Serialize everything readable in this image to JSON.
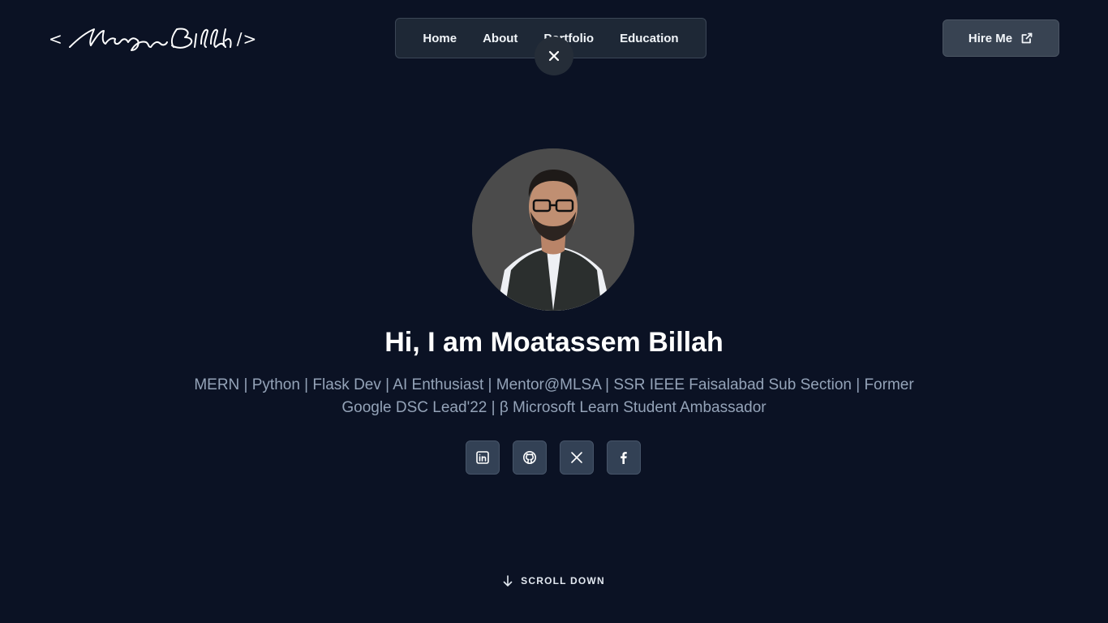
{
  "logo": {
    "open": "<",
    "name": "Moatassem Billah",
    "close": "/>"
  },
  "nav": {
    "items": [
      {
        "label": "Home"
      },
      {
        "label": "About"
      },
      {
        "label": "Portfolio"
      },
      {
        "label": "Education"
      }
    ],
    "close_icon": "close-icon"
  },
  "hire": {
    "label": "Hire Me",
    "icon": "external-link-icon"
  },
  "hero": {
    "headline": "Hi, I am Moatassem Billah",
    "tagline": "MERN | Python | Flask Dev | AI Enthusiast | Mentor@MLSA | SSR IEEE Faisalabad Sub Section | Former Google DSC Lead'22 | β Microsoft Learn Student Ambassador"
  },
  "socials": [
    {
      "icon": "linkedin-icon"
    },
    {
      "icon": "github-icon"
    },
    {
      "icon": "x-icon"
    },
    {
      "icon": "facebook-icon"
    }
  ],
  "scroll": {
    "label": "SCROLL DOWN",
    "icon": "arrow-down-icon"
  },
  "colors": {
    "background": "#0b1224",
    "nav_bg": "#1e2836",
    "button_bg": "#384352",
    "muted_text": "#94a3b8"
  }
}
